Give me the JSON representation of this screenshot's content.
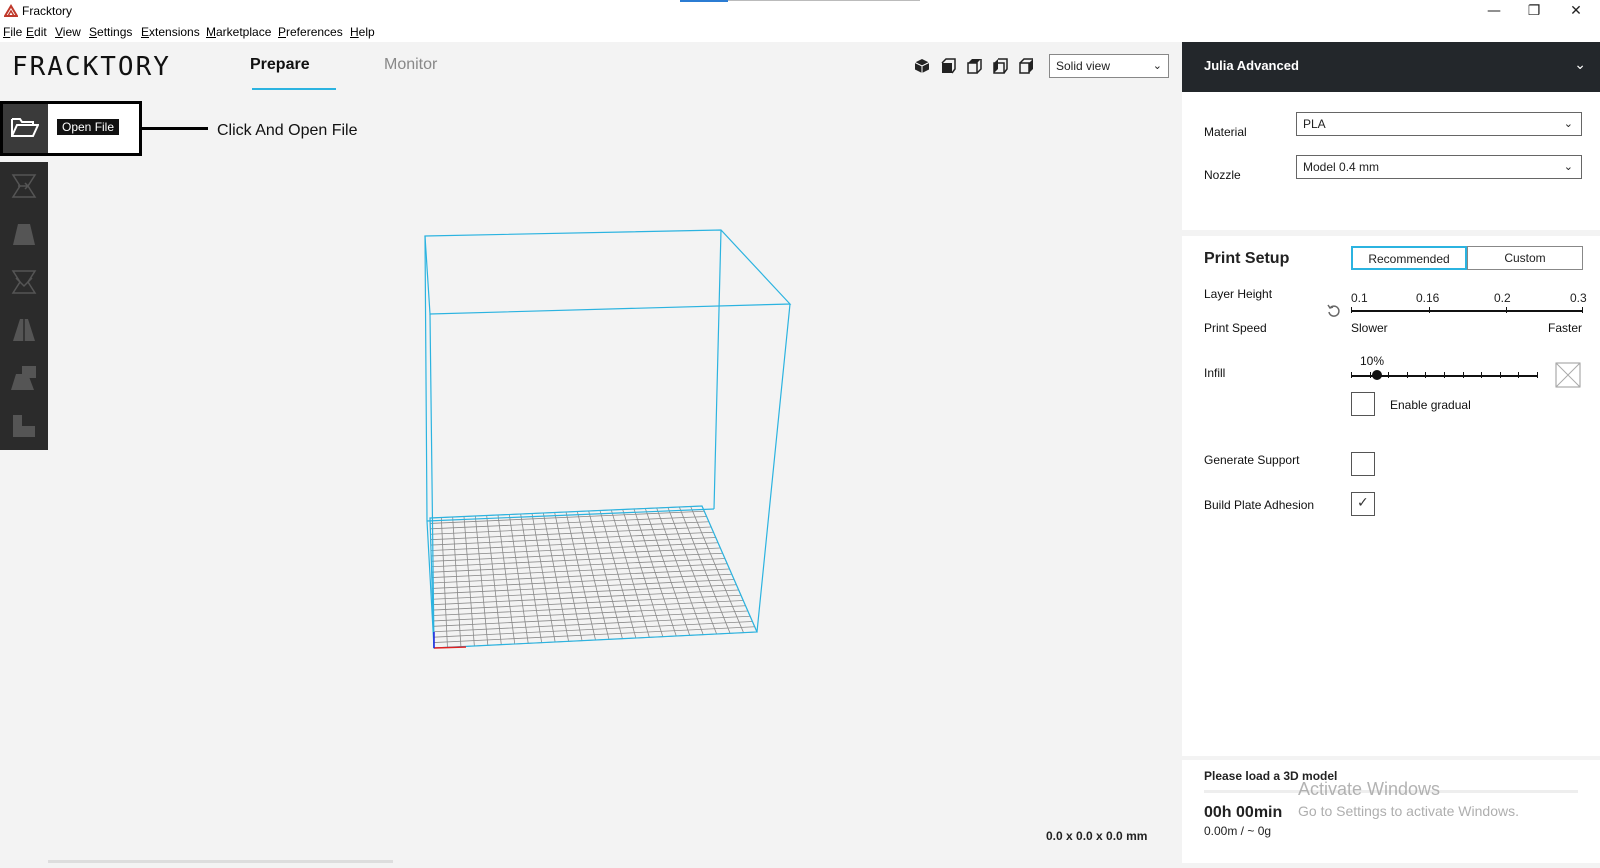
{
  "window": {
    "title": "Fracktory",
    "minimize": "—",
    "maximize": "❐",
    "close": "✕"
  },
  "menu": [
    "File",
    "Edit",
    "View",
    "Settings",
    "Extensions",
    "Marketplace",
    "Preferences",
    "Help"
  ],
  "header": {
    "logo": "FRACKTORY",
    "tabs": [
      {
        "label": "Prepare",
        "active": true
      },
      {
        "label": "Monitor",
        "active": false
      }
    ],
    "view_mode": "Solid view",
    "view_icons": [
      "3d-view-icon",
      "front-view-icon",
      "top-view-icon",
      "left-view-icon",
      "right-view-icon"
    ]
  },
  "toolbar": {
    "open_tooltip": "Open File",
    "callout": "Click And Open File",
    "tools": [
      "move-icon",
      "scale-icon",
      "rotate-icon",
      "mirror-icon",
      "per-model-settings-icon",
      "support-blocker-icon"
    ]
  },
  "viewport": {
    "dimensions": "0.0 x 0.0 x 0.0 mm",
    "accent_color": "#2bb3e0"
  },
  "panel": {
    "printer": "Julia Advanced",
    "material_label": "Material",
    "material_value": "PLA",
    "nozzle_label": "Nozzle",
    "nozzle_value": "Model 0.4 mm",
    "print_setup": {
      "title": "Print Setup",
      "modes": [
        {
          "label": "Recommended",
          "active": true
        },
        {
          "label": "Custom",
          "active": false
        }
      ],
      "layer_height_label": "Layer Height",
      "layer_heights": [
        "0.1",
        "0.16",
        "0.2",
        "0.3"
      ],
      "print_speed_label": "Print Speed",
      "speed_slower": "Slower",
      "speed_faster": "Faster",
      "infill_label": "Infill",
      "infill_value": "10%",
      "infill_fraction": 0.1,
      "gradual_label": "Enable gradual",
      "gradual_checked": false,
      "support_label": "Generate Support",
      "support_checked": false,
      "adhesion_label": "Build Plate Adhesion",
      "adhesion_checked": true
    },
    "status": {
      "message": "Please load a 3D model",
      "time": "00h 00min",
      "amount": "0.00m / ~ 0g"
    }
  },
  "watermark": {
    "line1": "Activate Windows",
    "line2": "Go to Settings to activate Windows."
  }
}
